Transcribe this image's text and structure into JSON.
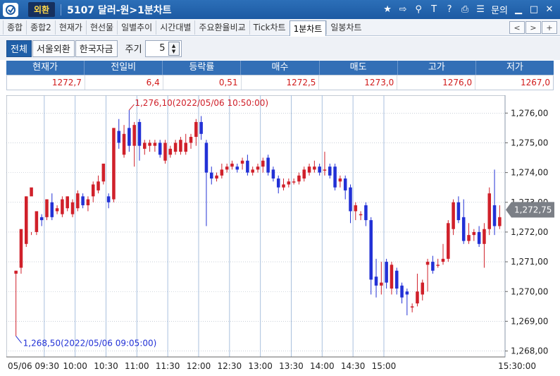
{
  "window": {
    "category": "외환",
    "title": "5107 달러-원>1분차트",
    "inquiry_label": "문의"
  },
  "tabs": [
    "종합",
    "종합2",
    "현재가",
    "현선물",
    "일별추이",
    "시간대별",
    "주요환율비교",
    "Tick차트",
    "1분차트",
    "일봉차트"
  ],
  "active_tab": "1분차트",
  "nav": {
    "prev": "<",
    "next": ">",
    "add": "+"
  },
  "filters": {
    "all": "전체",
    "seoul": "서울외환",
    "korea_fund": "한국자금"
  },
  "period": {
    "label": "주기",
    "value": "5"
  },
  "quote": {
    "headers": [
      "현재가",
      "전일비",
      "등락률",
      "매수",
      "매도",
      "고가",
      "저가"
    ],
    "values": [
      "1272,7",
      "6,4",
      "0,51",
      "1272,5",
      "1273,0",
      "1276,0",
      "1267,0"
    ]
  },
  "chart_data": {
    "type": "candlestick",
    "y_range": [
      1267.8,
      1276.6
    ],
    "y_ticks": [
      "1,276,00",
      "1,275,00",
      "1,274,00",
      "1,273,00",
      "1,272,00",
      "1,271,00",
      "1,270,00",
      "1,269,00",
      "1,268,00"
    ],
    "y_tick_values": [
      1276,
      1275,
      1274,
      1273,
      1272,
      1271,
      1270,
      1269,
      1268
    ],
    "x_ticks": [
      "05/06 09:30",
      "10:00",
      "10:30",
      "11:00",
      "11:30",
      "12:00",
      "12:30",
      "13:00",
      "13:30",
      "14:00",
      "14:30",
      "15:00",
      "15:30:00"
    ],
    "current_price_label": "1,272,75",
    "current_price": 1272.75,
    "annotations": {
      "high": "1,276,10(2022/05/06 10:50:00)",
      "low": "1,268,50(2022/05/06 09:05:00)"
    },
    "candles": [
      [
        1270.6,
        1270.7,
        1268.5,
        1270.7
      ],
      [
        1270.8,
        1272.1,
        1270.6,
        1271.3
      ],
      [
        1271.6,
        1273.2,
        1271.5,
        1273.2
      ],
      [
        1273.2,
        1273.5,
        1271.9,
        1272.0
      ],
      [
        1272.0,
        1272.7,
        1271.9,
        1272.6
      ],
      [
        1272.5,
        1272.4,
        1272.2,
        1272.6
      ],
      [
        1272.5,
        1273.1,
        1272.4,
        1273.1
      ],
      [
        1273.0,
        1272.5,
        1272.4,
        1273.3
      ],
      [
        1272.7,
        1272.8,
        1272.6,
        1272.9
      ],
      [
        1272.6,
        1273.1,
        1272.5,
        1273.2
      ],
      [
        1272.8,
        1273.2,
        1272.7,
        1273.2
      ],
      [
        1272.6,
        1273.0,
        1272.5,
        1273.1
      ],
      [
        1272.8,
        1273.3,
        1272.7,
        1273.4
      ],
      [
        1273.2,
        1272.9,
        1272.8,
        1273.3
      ],
      [
        1272.9,
        1273.1,
        1272.7,
        1273.2
      ],
      [
        1273.2,
        1273.6,
        1273.0,
        1273.7
      ],
      [
        1273.4,
        1273.7,
        1273.3,
        1273.9
      ],
      [
        1273.7,
        1274.3,
        1273.6,
        1274.3
      ],
      [
        1273.2,
        1273.0,
        1272.8,
        1273.3
      ],
      [
        1273.1,
        1275.5,
        1273.0,
        1275.5
      ],
      [
        1275.4,
        1275.0,
        1274.8,
        1275.8
      ],
      [
        1274.6,
        1275.3,
        1274.5,
        1275.6
      ],
      [
        1275.5,
        1274.9,
        1274.7,
        1276.1
      ],
      [
        1274.9,
        1275.6,
        1274.2,
        1275.7
      ],
      [
        1275.7,
        1274.9,
        1274.4,
        1275.8
      ],
      [
        1274.8,
        1275.0,
        1274.6,
        1275.1
      ],
      [
        1274.9,
        1275.0,
        1274.7,
        1275.1
      ],
      [
        1274.9,
        1275.0,
        1274.7,
        1275.1
      ],
      [
        1275.0,
        1274.6,
        1274.5,
        1275.1
      ],
      [
        1274.4,
        1275.0,
        1274.3,
        1275.1
      ],
      [
        1274.6,
        1274.8,
        1274.5,
        1274.9
      ],
      [
        1274.7,
        1275.0,
        1274.6,
        1275.1
      ],
      [
        1274.7,
        1275.1,
        1274.6,
        1275.2
      ],
      [
        1274.7,
        1275.0,
        1274.6,
        1275.3
      ],
      [
        1275.0,
        1275.2,
        1274.8,
        1275.3
      ],
      [
        1275.2,
        1275.7,
        1274.9,
        1275.8
      ],
      [
        1275.7,
        1275.3,
        1275.1,
        1275.9
      ],
      [
        1275.0,
        1274.0,
        1272.2,
        1275.1
      ],
      [
        1274.0,
        1273.8,
        1273.6,
        1274.2
      ],
      [
        1273.8,
        1273.9,
        1273.7,
        1274.0
      ],
      [
        1273.9,
        1274.1,
        1273.8,
        1274.3
      ],
      [
        1274.1,
        1274.2,
        1274.0,
        1274.3
      ],
      [
        1274.2,
        1274.3,
        1274.1,
        1274.4
      ],
      [
        1274.2,
        1274.1,
        1274.0,
        1274.3
      ],
      [
        1274.3,
        1274.4,
        1274.1,
        1274.5
      ],
      [
        1274.4,
        1274.0,
        1273.9,
        1274.6
      ],
      [
        1274.0,
        1274.1,
        1273.9,
        1274.2
      ],
      [
        1274.1,
        1274.2,
        1274.0,
        1274.3
      ],
      [
        1274.2,
        1274.4,
        1274.0,
        1274.5
      ],
      [
        1274.5,
        1274.0,
        1273.9,
        1274.6
      ],
      [
        1274.1,
        1273.8,
        1273.7,
        1274.2
      ],
      [
        1273.8,
        1273.5,
        1273.3,
        1273.9
      ],
      [
        1273.5,
        1273.6,
        1273.4,
        1273.8
      ],
      [
        1273.6,
        1273.7,
        1273.5,
        1273.8
      ],
      [
        1273.7,
        1273.7,
        1273.6,
        1273.8
      ],
      [
        1273.7,
        1273.9,
        1273.6,
        1274.0
      ],
      [
        1273.8,
        1274.1,
        1273.7,
        1274.2
      ],
      [
        1274.0,
        1274.2,
        1273.9,
        1274.3
      ],
      [
        1274.1,
        1274.2,
        1274.0,
        1274.4
      ],
      [
        1274.2,
        1274.0,
        1273.9,
        1274.3
      ],
      [
        1274.1,
        1274.1,
        1273.9,
        1274.7
      ],
      [
        1274.2,
        1273.9,
        1273.8,
        1274.3
      ],
      [
        1274.2,
        1273.5,
        1273.4,
        1274.3
      ],
      [
        1273.7,
        1273.8,
        1273.5,
        1273.9
      ],
      [
        1273.8,
        1273.4,
        1273.1,
        1273.9
      ],
      [
        1273.5,
        1272.7,
        1272.3,
        1273.6
      ],
      [
        1272.7,
        1272.9,
        1272.4,
        1273.0
      ],
      [
        1272.6,
        1272.6,
        1272.4,
        1272.7
      ],
      [
        1272.9,
        1272.4,
        1272.2,
        1273.0
      ],
      [
        1272.4,
        1270.4,
        1269.9,
        1272.5
      ],
      [
        1270.5,
        1270.2,
        1269.8,
        1271.1
      ],
      [
        1270.2,
        1270.3,
        1269.9,
        1271.0
      ],
      [
        1271.0,
        1270.3,
        1270.1,
        1271.1
      ],
      [
        1270.1,
        1270.9,
        1269.9,
        1271.0
      ],
      [
        1270.7,
        1270.1,
        1269.9,
        1270.8
      ],
      [
        1270.2,
        1269.8,
        1269.6,
        1270.3
      ],
      [
        1270.0,
        1269.9,
        1269.2,
        1270.1
      ],
      [
        1269.5,
        1269.5,
        1269.3,
        1269.6
      ],
      [
        1269.6,
        1270.0,
        1269.5,
        1270.6
      ],
      [
        1269.9,
        1270.3,
        1269.7,
        1270.4
      ],
      [
        1270.9,
        1271.0,
        1270.0,
        1271.1
      ],
      [
        1271.0,
        1270.7,
        1270.6,
        1271.2
      ],
      [
        1270.9,
        1270.9,
        1270.8,
        1271.1
      ],
      [
        1271.0,
        1271.1,
        1270.9,
        1271.6
      ],
      [
        1271.1,
        1272.3,
        1271.0,
        1272.4
      ],
      [
        1272.1,
        1273.0,
        1271.9,
        1273.1
      ],
      [
        1273.0,
        1272.4,
        1272.3,
        1273.2
      ],
      [
        1272.5,
        1271.7,
        1271.6,
        1273.1
      ],
      [
        1271.7,
        1271.9,
        1271.6,
        1272.3
      ],
      [
        1271.9,
        1272.0,
        1271.7,
        1272.1
      ],
      [
        1272.0,
        1271.6,
        1271.5,
        1272.2
      ],
      [
        1271.6,
        1272.1,
        1270.8,
        1272.3
      ],
      [
        1272.1,
        1273.3,
        1271.9,
        1273.5
      ],
      [
        1272.9,
        1272.2,
        1271.9,
        1274.1
      ],
      [
        1272.2,
        1272.5,
        1272.1,
        1272.9
      ]
    ]
  }
}
